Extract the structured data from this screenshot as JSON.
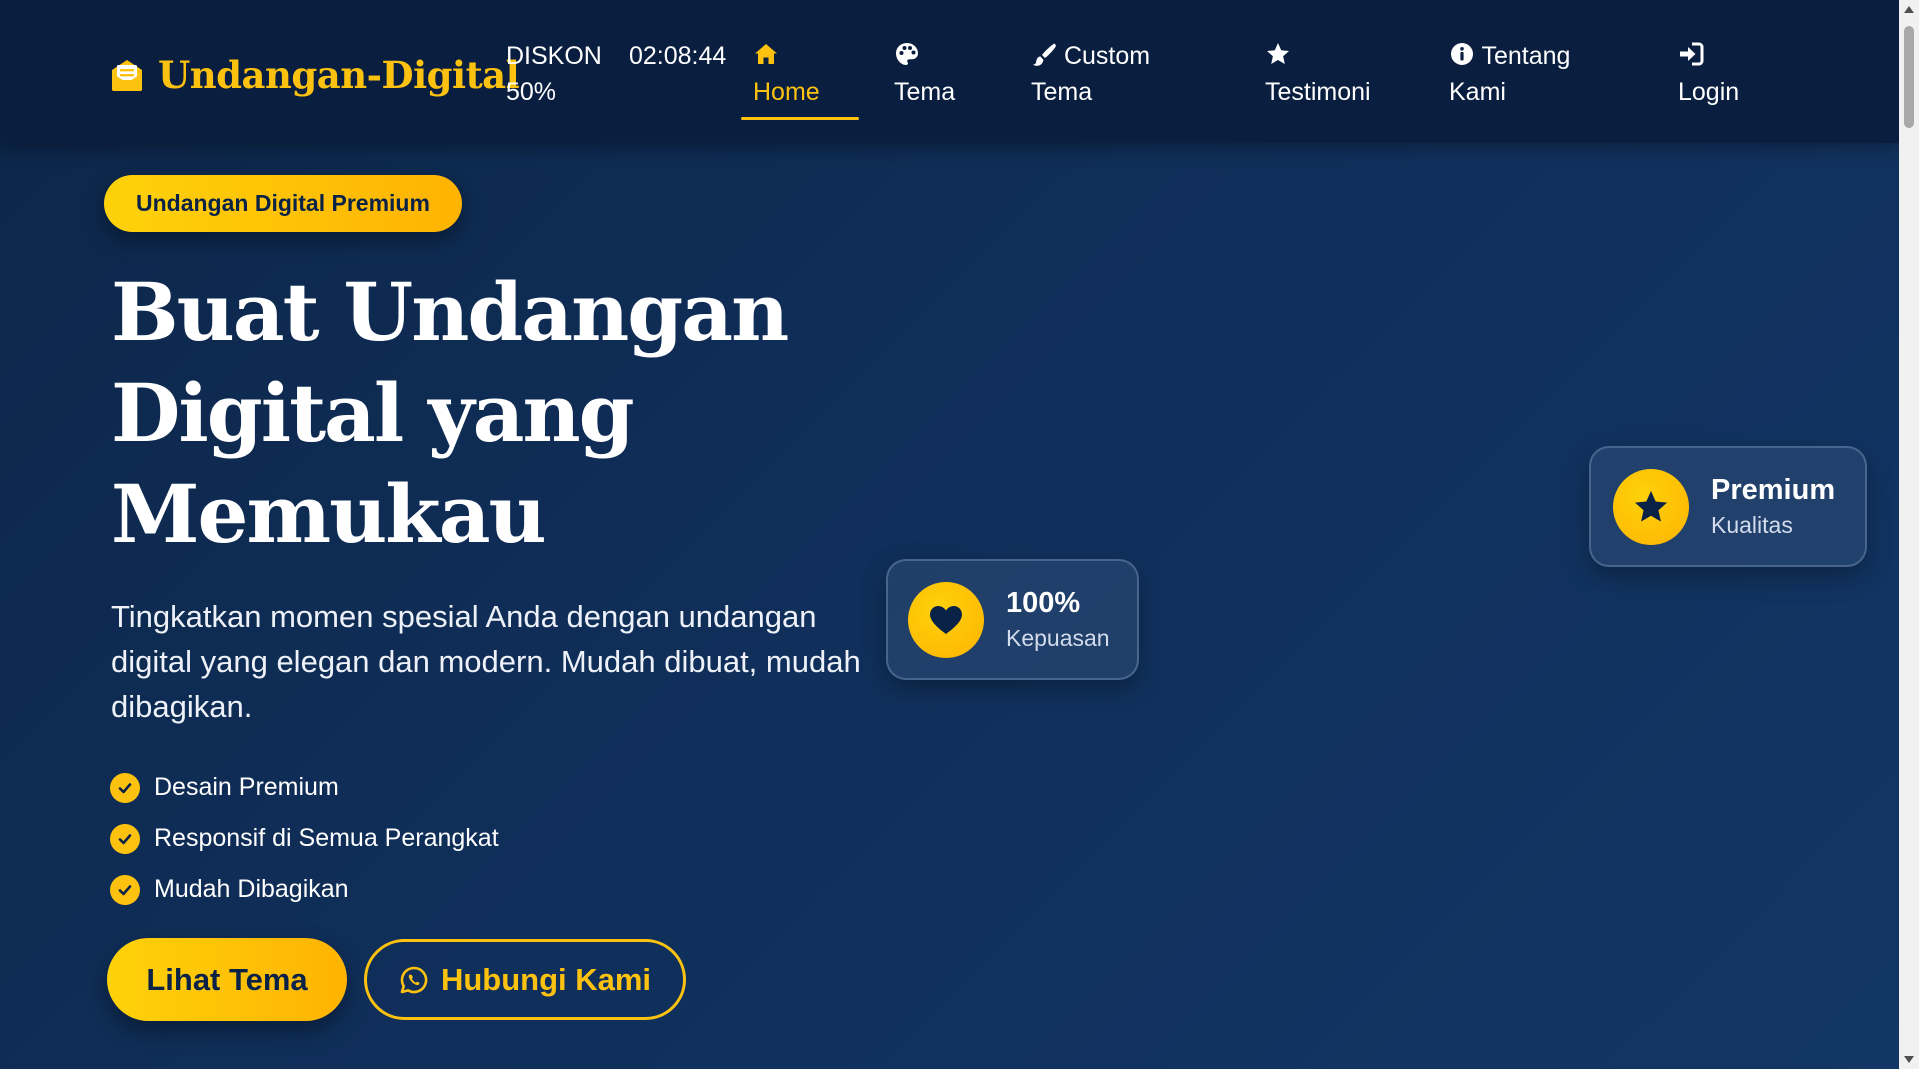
{
  "navbar": {
    "brand": "Undangan-Digital",
    "promo": "DISKON 50%",
    "timer": "02:08:44",
    "items": [
      {
        "label": "Home",
        "icon": "home-icon",
        "active": true
      },
      {
        "label": "Tema",
        "icon": "palette-icon"
      },
      {
        "label": "Custom Tema",
        "icon": "brush-icon"
      },
      {
        "label": "Testimoni",
        "icon": "star-icon"
      },
      {
        "label": "Tentang Kami",
        "icon": "info-icon"
      },
      {
        "label": "Login",
        "icon": "login-icon"
      }
    ]
  },
  "hero": {
    "badge": "Undangan Digital Premium",
    "title_line1": "Buat Undangan",
    "title_line2": "Digital yang",
    "title_line3": "Memukau",
    "description": "Tingkatkan momen spesial Anda dengan undangan digital yang elegan dan modern. Mudah dibuat, mudah dibagikan.",
    "features": [
      "Desain Premium",
      "Responsif di Semua Perangkat",
      "Mudah Dibagikan"
    ],
    "primary_button": "Lihat Tema",
    "secondary_button": "Hubungi Kami"
  },
  "cards": {
    "satisfaction": {
      "value": "100%",
      "label": "Kepuasan",
      "icon": "heart-icon"
    },
    "quality": {
      "value": "Premium",
      "label": "Kualitas",
      "icon": "star-icon"
    }
  },
  "colors": {
    "accent": "#fdc20f",
    "navbar_bg": "#0a1f3f",
    "hero_bg": "#10305c",
    "dark_text": "#0b2247"
  }
}
